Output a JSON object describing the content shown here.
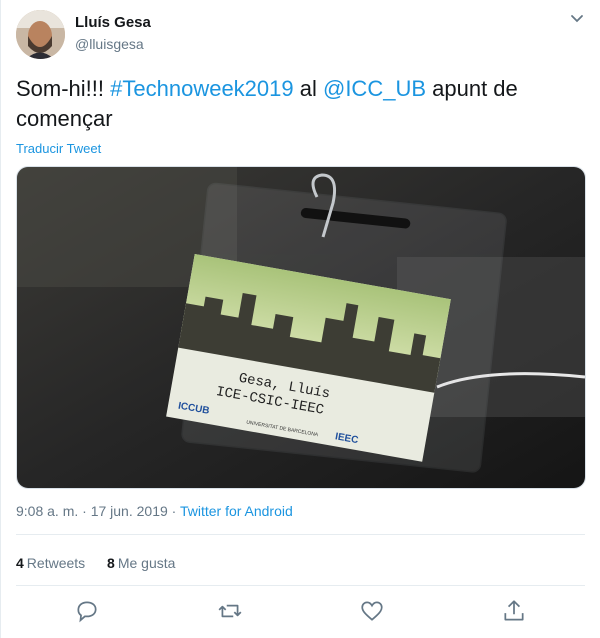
{
  "author": {
    "name": "Lluís Gesa",
    "handle": "@lluisgesa"
  },
  "tweet": {
    "text_parts": [
      {
        "text": "Som-hi!!! ",
        "link": false
      },
      {
        "text": "#Technoweek2019",
        "link": true
      },
      {
        "text": " al ",
        "link": false
      },
      {
        "text": "@ICC_UB",
        "link": true
      },
      {
        "text": " apunt de començar",
        "link": false
      }
    ],
    "translate_label": "Traducir Tweet"
  },
  "badge": {
    "line1": "Gesa, Lluís",
    "line2": "ICE-CSIC-IEEC",
    "logo1": "ICCUB",
    "logo2": "UNIVERSITAT DE BARCELONA",
    "logo3": "IEEC"
  },
  "meta": {
    "time": "9:08 a. m. · 17 jun. 2019 · ",
    "app": "Twitter for Android"
  },
  "stats": {
    "retweets_count": "4",
    "retweets_label": "Retweets",
    "likes_count": "8",
    "likes_label": "Me gusta"
  },
  "icons": [
    "chevron-down-icon",
    "reply-icon",
    "retweet-icon",
    "like-icon",
    "share-icon"
  ],
  "colors": {
    "link": "#1b95e0",
    "secondary_text": "#657786",
    "icon": "#657786"
  }
}
